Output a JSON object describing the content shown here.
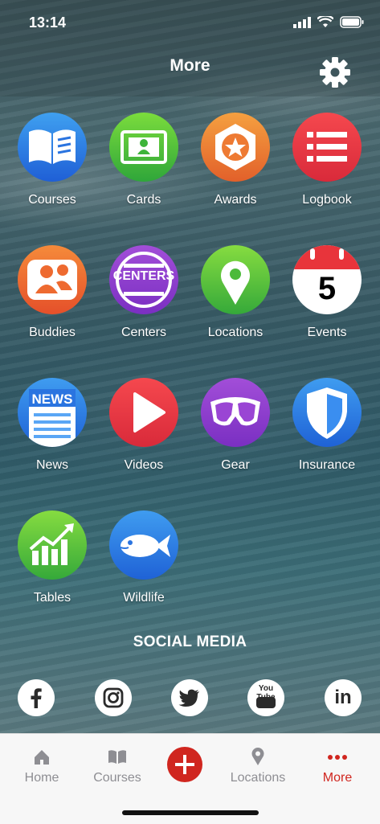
{
  "status_bar": {
    "time": "13:14"
  },
  "header": {
    "title": "More"
  },
  "grid": {
    "items": [
      {
        "label": "Courses"
      },
      {
        "label": "Cards"
      },
      {
        "label": "Awards"
      },
      {
        "label": "Logbook"
      },
      {
        "label": "Buddies"
      },
      {
        "label": "Centers",
        "badge_text": "CENTERS"
      },
      {
        "label": "Locations"
      },
      {
        "label": "Events",
        "calendar_day": "5"
      },
      {
        "label": "News",
        "badge_text": "NEWS"
      },
      {
        "label": "Videos"
      },
      {
        "label": "Gear"
      },
      {
        "label": "Insurance"
      },
      {
        "label": "Tables"
      },
      {
        "label": "Wildlife"
      }
    ]
  },
  "social": {
    "title": "SOCIAL MEDIA",
    "links": [
      {
        "icon": "facebook-icon"
      },
      {
        "icon": "instagram-icon"
      },
      {
        "icon": "twitter-icon"
      },
      {
        "icon": "youtube-icon",
        "text": "You Tube"
      },
      {
        "icon": "linkedin-icon",
        "text": "in"
      }
    ]
  },
  "tabbar": {
    "tabs": [
      {
        "label": "Home"
      },
      {
        "label": "Courses"
      },
      {
        "label": ""
      },
      {
        "label": "Locations"
      },
      {
        "label": "More"
      }
    ],
    "active_color": "#d0261f"
  }
}
